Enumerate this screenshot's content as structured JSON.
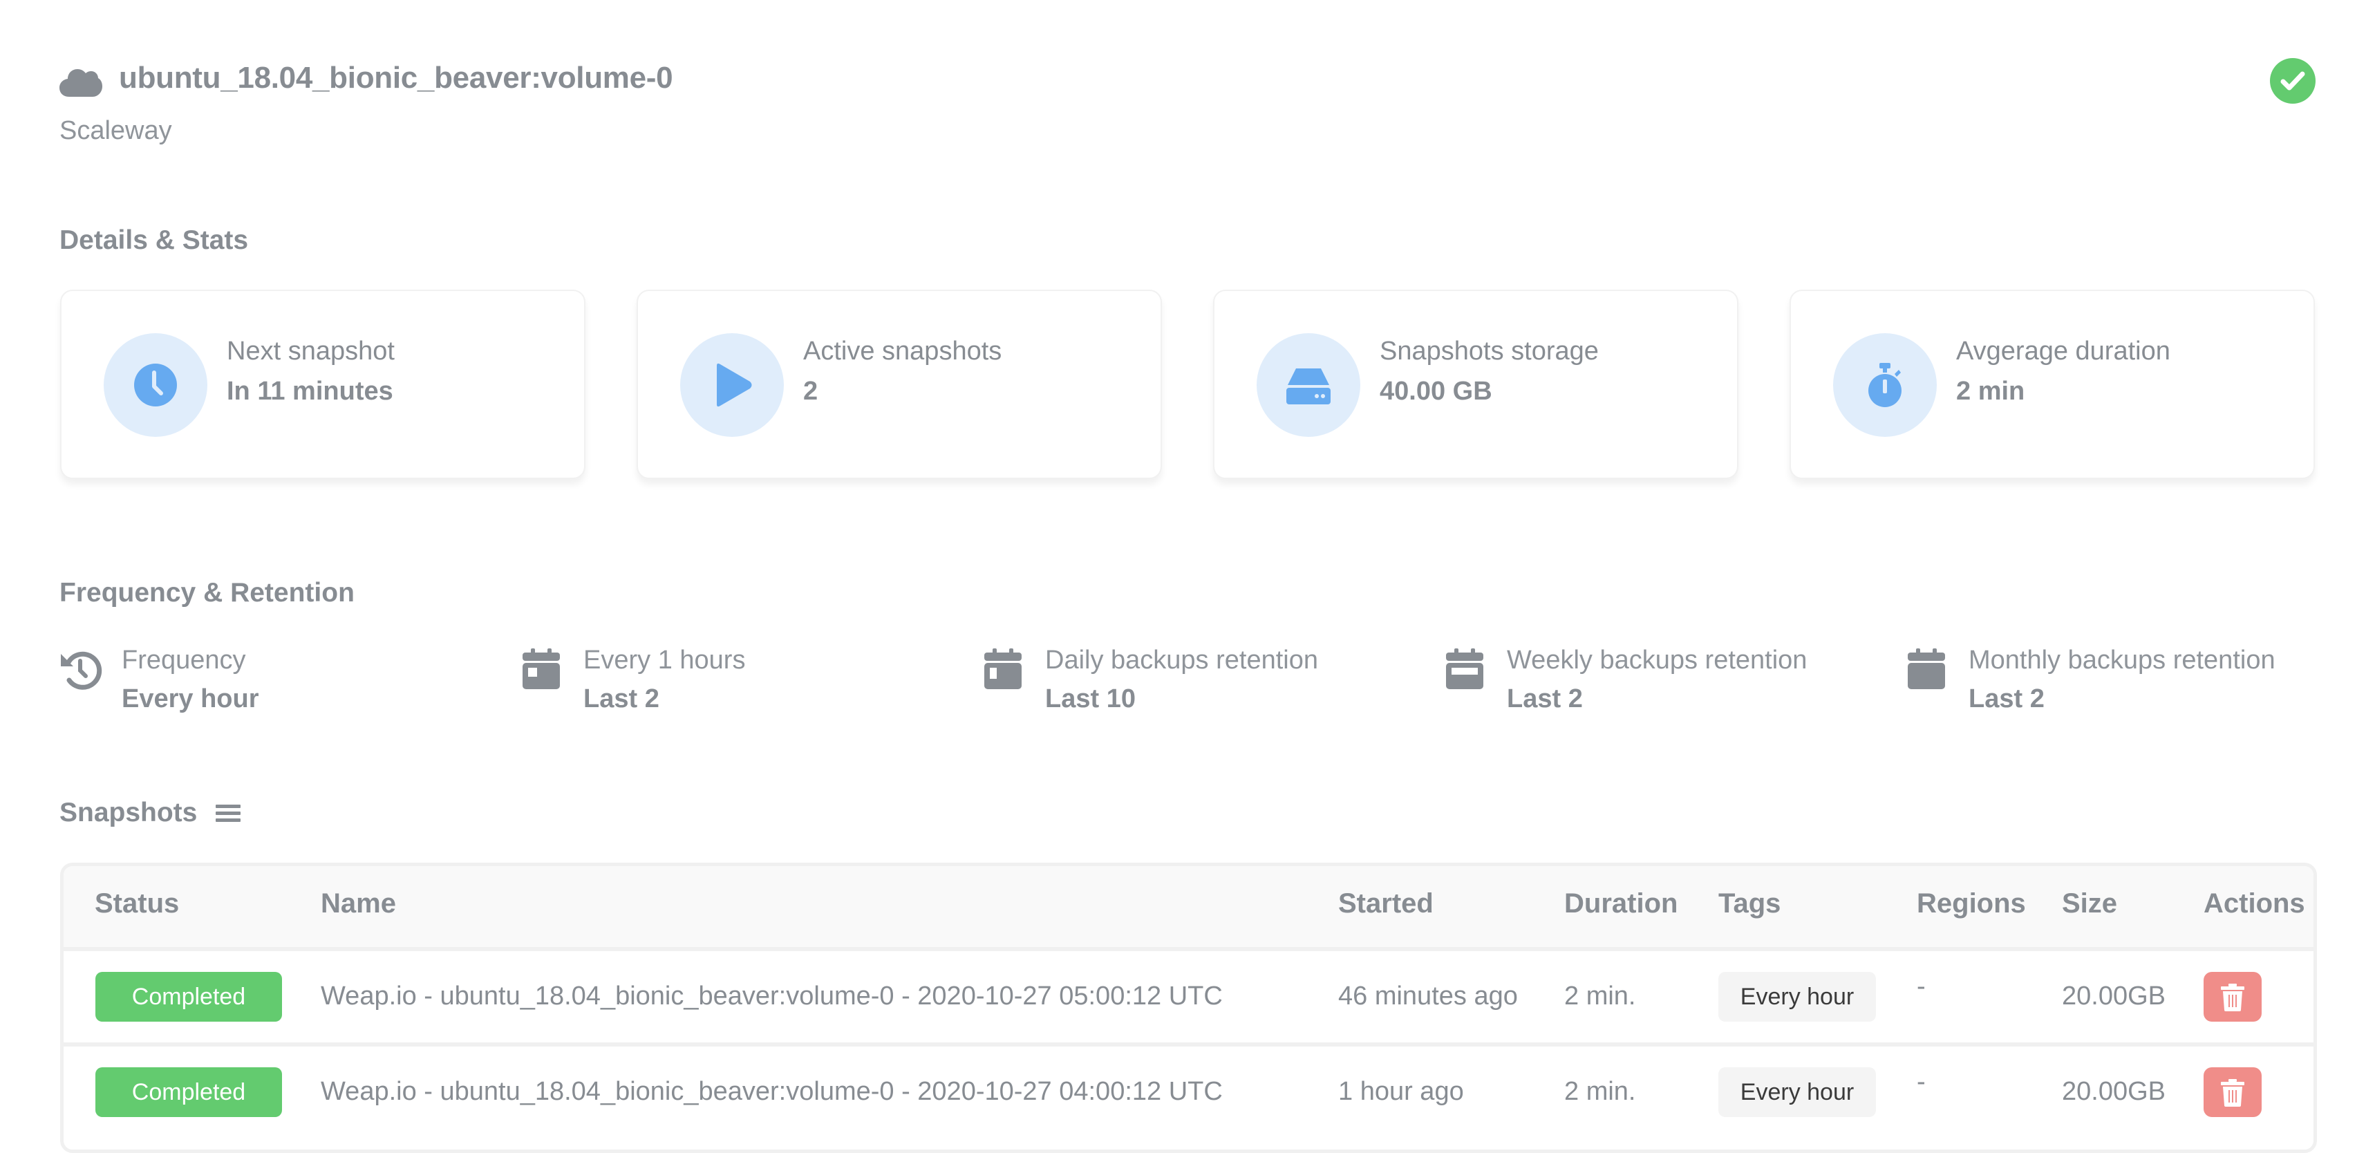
{
  "header": {
    "title": "ubuntu_18.04_bionic_beaver:volume-0",
    "provider": "Scaleway",
    "title_icon": "cloud-icon",
    "status_icon": "check-circle-icon",
    "status_color": "#63cb6f"
  },
  "details": {
    "title": "Details & Stats",
    "cards": [
      {
        "icon": "clock-icon",
        "label": "Next snapshot",
        "value": "In 11 minutes"
      },
      {
        "icon": "play-icon",
        "label": "Active snapshots",
        "value": "2"
      },
      {
        "icon": "hdd-icon",
        "label": "Snapshots storage",
        "value": "40.00 GB"
      },
      {
        "icon": "stopwatch-icon",
        "label": "Avgerage duration",
        "value": "2 min"
      }
    ],
    "accent_color": "#66aaf0",
    "icon_bg_color": "#e0edfb"
  },
  "frequency": {
    "title": "Frequency & Retention",
    "items": [
      {
        "icon": "history-icon",
        "label": "Frequency",
        "value": "Every hour"
      },
      {
        "icon": "calendar-day-icon",
        "label": "Every 1 hours",
        "value": "Last 2"
      },
      {
        "icon": "calendar-day-icon",
        "label": "Daily backups retention",
        "value": "Last 10"
      },
      {
        "icon": "calendar-week-icon",
        "label": "Weekly backups retention",
        "value": "Last 2"
      },
      {
        "icon": "calendar-icon",
        "label": "Monthly backups retention",
        "value": "Last 2"
      }
    ]
  },
  "snapshots": {
    "title": "Snapshots",
    "title_icon": "list-icon",
    "columns": [
      "Status",
      "Name",
      "Started",
      "Duration",
      "Tags",
      "Regions",
      "Size",
      "Actions"
    ],
    "rows": [
      {
        "status": "Completed",
        "name": "Weap.io - ubuntu_18.04_bionic_beaver:volume-0 - 2020-10-27 05:00:12 UTC",
        "started": "46 minutes ago",
        "duration": "2 min.",
        "tag": "Every hour",
        "regions": "-",
        "size": "20.00GB",
        "action_icon": "trash-icon"
      },
      {
        "status": "Completed",
        "name": "Weap.io - ubuntu_18.04_bionic_beaver:volume-0 - 2020-10-27 04:00:12 UTC",
        "started": "1 hour ago",
        "duration": "2 min.",
        "tag": "Every hour",
        "regions": "-",
        "size": "20.00GB",
        "action_icon": "trash-icon"
      }
    ],
    "status_color": "#63cb6f",
    "delete_color": "#f08d89"
  }
}
